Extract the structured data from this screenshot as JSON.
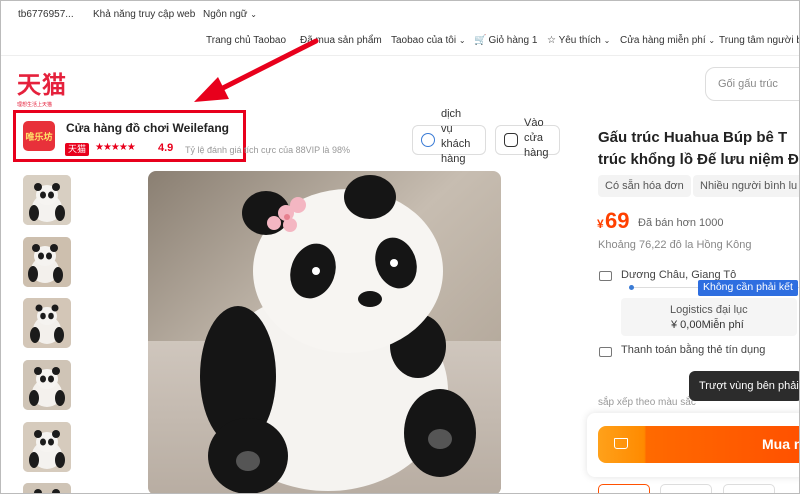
{
  "topbar": {
    "account": "tb6776957...",
    "accessibility": "Khả năng truy cập web",
    "language": "Ngôn ngữ"
  },
  "nav": {
    "items": [
      "Trang chủ Taobao",
      "Đã mua sản phẩm",
      "Taobao của tôi",
      "Giỏ hàng 1",
      "Yêu thích",
      "Cửa hàng miễn phí",
      "Trung tâm người bán"
    ]
  },
  "logo": {
    "text": "天猫",
    "slogan": "理想生活上天猫"
  },
  "search": {
    "placeholder": "Gối gấu trúc"
  },
  "shop": {
    "icon_text": "唯乐坊",
    "name": "Cửa hàng đồ chơi Weilefang",
    "badge": "天猫",
    "stars": "★★★★★",
    "rating": "4.9",
    "positive_rate": "Tỷ lệ đánh giá tích cực của 88VIP là 98%"
  },
  "service": {
    "customer_service": [
      "dịch",
      "vụ",
      "khách",
      "hàng"
    ],
    "visit_store": [
      "Vào",
      "cửa",
      "hàng"
    ]
  },
  "product": {
    "title_line1": "Gấu trúc Huahua Búp bê T",
    "title_line2": "trúc khổng lồ Đế lưu niệm Đ",
    "tags": [
      "Có sẵn hóa đơn",
      "Nhiều người bình lu"
    ],
    "currency": "¥",
    "price": "69",
    "sold": "Đã bán hơn 1000",
    "hk_distance": "Khoảng 76,22 đô la Hồng Kông",
    "route": "Dương Châu, Giang Tô",
    "no_check": "Không cần phải kết",
    "logistics": "Logistics đại lục",
    "logistics_fee": "¥ 0,00Miễn phí",
    "payment": "Thanh toán bằng thẻ tín dụng",
    "tooltip": "Trượt vùng bên phải",
    "sort": "sắp xếp theo màu sắc",
    "buy": "Mua n"
  },
  "colors": {
    "tmall_red": "#e8001c",
    "price_orange": "#ff4000",
    "buy_orange": "#ff5000",
    "shipping_blue": "#2e6ee0"
  }
}
